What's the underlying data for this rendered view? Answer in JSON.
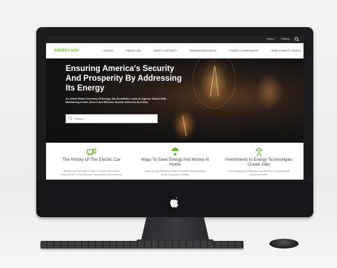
{
  "site": {
    "logo": "ENERGY.GOV",
    "utility_links": [
      "About",
      "Offices"
    ],
    "nav": [
      "SCIENCE",
      "ENERGY USE",
      "SAFETY & SECURITY",
      "BUSINESS RESOURCES",
      "CLIMATE & ENVIRONMENT",
      "HOME & ENERGY SAVINGS"
    ],
    "hero": {
      "title": "Ensuring America's Security And Prosperity By Addressing Its Energy",
      "subtitle": "As United States Secretary Of Energy, Dan Brouillette Leads An Agency Tasked With Maintaining A Safe, Secure And Effective Nuclear Deterrent And More.",
      "search_placeholder": "Search"
    },
    "cards": [
      {
        "icon": "car-charging-icon",
        "title": "The History Of The Electric Car",
        "text": "Vehicles And The Fuels It Takes To Power Them Are An Essential Part Of Our American Infrastructure And Economy."
      },
      {
        "icon": "energy-saving-icon",
        "title": "Ways To Save Energy And Money At Home",
        "text": "Home Energy Efficiency Is Often Dominated By Discussions About Cooling And Heating."
      },
      {
        "icon": "wind-signal-icon",
        "title": "Investments In Energy Technologies Create Jobs",
        "text": "From Building And Financing Opportunities To Helping Small Businesses Work."
      }
    ],
    "accent": "#6cb22e"
  }
}
